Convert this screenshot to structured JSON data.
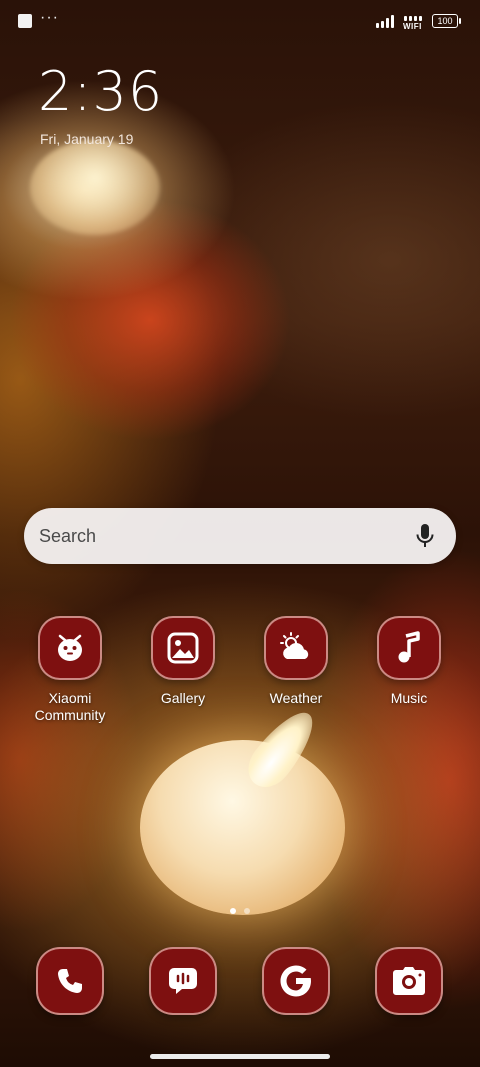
{
  "status_bar": {
    "dots": "···",
    "wifi_label": "WIFI",
    "battery": "100"
  },
  "lockscreen": {
    "time": "2:36",
    "date": "Fri, January 19"
  },
  "search": {
    "placeholder": "Search"
  },
  "apps": [
    {
      "label": "Xiaomi Community",
      "icon": "xiaomi-community-icon"
    },
    {
      "label": "Gallery",
      "icon": "gallery-icon"
    },
    {
      "label": "Weather",
      "icon": "weather-icon"
    },
    {
      "label": "Music",
      "icon": "music-icon"
    }
  ],
  "dock": [
    {
      "icon": "phone-icon"
    },
    {
      "icon": "messages-icon"
    },
    {
      "icon": "google-icon"
    },
    {
      "icon": "camera-icon"
    }
  ],
  "pager": {
    "pages": 2,
    "current": 1
  },
  "colors": {
    "icon_background": "#7e1010",
    "search_background": "#f5f2f2"
  }
}
